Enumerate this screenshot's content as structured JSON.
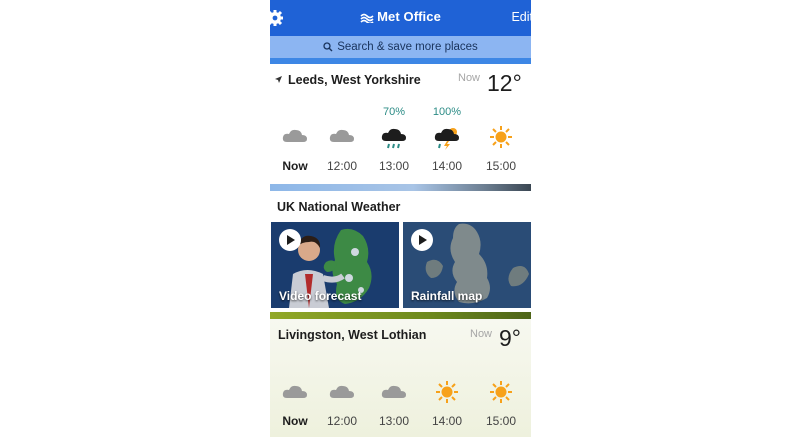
{
  "header": {
    "brand": "Met Office",
    "edit_label": "Edit"
  },
  "search": {
    "label": "Search & save more places"
  },
  "locations": [
    {
      "name": "Leeds, West Yorkshire",
      "now_label": "Now",
      "temperature": "12°",
      "forecast": [
        {
          "time": "Now",
          "icon": "cloud-icon",
          "rain_chance": ""
        },
        {
          "time": "12:00",
          "icon": "cloud-icon",
          "rain_chance": ""
        },
        {
          "time": "13:00",
          "icon": "heavy-rain-cloud-icon",
          "rain_chance": "70%"
        },
        {
          "time": "14:00",
          "icon": "thunderstorm-icon",
          "rain_chance": "100%"
        },
        {
          "time": "15:00",
          "icon": "sun-icon",
          "rain_chance": ""
        }
      ]
    },
    {
      "name": "Livingston, West Lothian",
      "now_label": "Now",
      "temperature": "9°",
      "forecast": [
        {
          "time": "Now",
          "icon": "cloud-icon"
        },
        {
          "time": "12:00",
          "icon": "cloud-icon"
        },
        {
          "time": "13:00",
          "icon": "cloud-icon"
        },
        {
          "time": "14:00",
          "icon": "sun-icon"
        },
        {
          "time": "15:00",
          "icon": "sun-icon"
        }
      ]
    }
  ],
  "national": {
    "title": "UK National Weather",
    "tiles": [
      {
        "label": "Video forecast"
      },
      {
        "label": "Rainfall map"
      }
    ]
  },
  "colors": {
    "header": "#1f62d6",
    "search_bar": "#8cb5f2",
    "rain_chance": "#2c8c86",
    "sun": "#f7a11a",
    "cloud": "#9a9a9a"
  }
}
